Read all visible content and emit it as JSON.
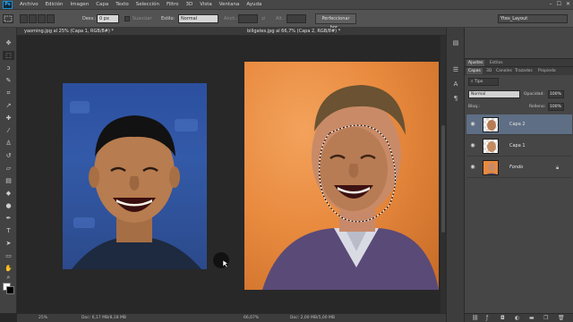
{
  "app": {
    "logo": "Ps"
  },
  "menu": [
    "Archivo",
    "Edición",
    "Imagen",
    "Capa",
    "Texto",
    "Selección",
    "Filtro",
    "3D",
    "Vista",
    "Ventana",
    "Ayuda"
  ],
  "window_controls": [
    "–",
    "☐",
    "✕"
  ],
  "options": {
    "feather_label": "Desv.:",
    "feather_value": "0 px",
    "antialias_label": "Suavizar",
    "style_label": "Estilo:",
    "style_value": "Normal",
    "width_label": "Anch.:",
    "height_label": "Alt.:",
    "refine_button": "Perfeccionar bor...",
    "workspace": "Ytes_Layout"
  },
  "documents": [
    {
      "tab": "yaoming.jpg al 25% (Capa 1, RGB/8#) *",
      "zoom": "25%",
      "doc_info": "Doc: 6,17 MB/8,18 MB"
    },
    {
      "tab": "billgates.jpg al 66,7% (Capa 2, RGB/8#) *",
      "zoom": "66,67%",
      "doc_info": "Doc: 2,00 MB/5,00 MB"
    }
  ],
  "panels": {
    "adjust_tabs": [
      "Ajustes",
      "Estilos"
    ],
    "layer_tabs": [
      "Capas",
      "3D",
      "Canales",
      "Trazados",
      "Propieda"
    ],
    "kind_filter": "Tipo",
    "blend_mode": "Normal",
    "opacity_label": "Opacidad:",
    "opacity_value": "100%",
    "lock_label": "Bloq.:",
    "fill_label": "Relleno:",
    "fill_value": "100%",
    "layers": [
      {
        "name": "Capa 2",
        "selected": true
      },
      {
        "name": "Capa 1",
        "selected": false
      },
      {
        "name": "Fondo",
        "selected": false
      }
    ]
  },
  "colors": {
    "accent": "#31a8ff",
    "selected_layer": "#5e6e84",
    "foreground": "#ffffff",
    "background": "#000000"
  },
  "icons": {
    "tools": [
      "move-icon",
      "marquee-icon",
      "lasso-icon",
      "quick-select-icon",
      "crop-icon",
      "eyedropper-icon",
      "healing-icon",
      "brush-icon",
      "clone-stamp-icon",
      "history-brush-icon",
      "eraser-icon",
      "gradient-icon",
      "blur-icon",
      "dodge-icon",
      "pen-icon",
      "type-icon",
      "path-select-icon",
      "rectangle-icon",
      "hand-icon",
      "zoom-icon"
    ]
  }
}
